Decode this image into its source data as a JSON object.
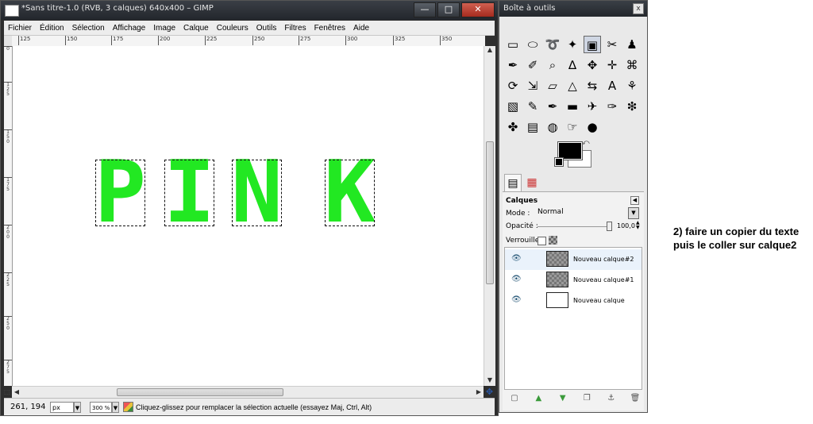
{
  "main_window": {
    "title": "*Sans titre-1.0 (RVB, 3 calques) 640x400 – GIMP",
    "controls": {
      "minimize": "—",
      "maximize": "□",
      "close": "✕"
    },
    "menu": [
      "Fichier",
      "Édition",
      "Sélection",
      "Affichage",
      "Image",
      "Calque",
      "Couleurs",
      "Outils",
      "Filtres",
      "Fenêtres",
      "Aide"
    ],
    "ruler_top_ticks": [
      "125",
      "150",
      "175",
      "200",
      "225",
      "250",
      "275",
      "300",
      "325",
      "350"
    ],
    "ruler_left_ticks": [
      "0",
      "1\n2\n5",
      "1\n5\n0",
      "1\n7\n5",
      "2\n0\n0",
      "2\n2\n5",
      "2\n5\n0",
      "2\n7\n5"
    ],
    "canvas_letters": [
      "P",
      "I",
      "N",
      "K"
    ],
    "statusbar": {
      "coords": "261, 194",
      "unit": "px",
      "zoom": "300 %",
      "message": "Cliquez-glissez pour remplacer la sélection actuelle (essayez Maj, Ctrl, Alt)"
    }
  },
  "toolbox": {
    "title": "Boîte à outils",
    "close": "x",
    "tools": [
      {
        "icon": "rect-select-icon",
        "glyph": "▭"
      },
      {
        "icon": "ellipse-select-icon",
        "glyph": "⬭"
      },
      {
        "icon": "lasso-icon",
        "glyph": "➰"
      },
      {
        "icon": "fuzzy-select-icon",
        "glyph": "✦"
      },
      {
        "icon": "color-select-icon",
        "glyph": "▣"
      },
      {
        "icon": "scissors-icon",
        "glyph": "✂"
      },
      {
        "icon": "foreground-select-icon",
        "glyph": "♟"
      },
      {
        "icon": "paths-icon",
        "glyph": "✒"
      },
      {
        "icon": "color-picker-icon",
        "glyph": "✐"
      },
      {
        "icon": "zoom-icon",
        "glyph": "⌕"
      },
      {
        "icon": "measure-icon",
        "glyph": "∆"
      },
      {
        "icon": "move-icon",
        "glyph": "✥"
      },
      {
        "icon": "align-icon",
        "glyph": "✛"
      },
      {
        "icon": "crop-icon",
        "glyph": "⌘"
      },
      {
        "icon": "rotate-icon",
        "glyph": "⟳"
      },
      {
        "icon": "scale-icon",
        "glyph": "⇲"
      },
      {
        "icon": "shear-icon",
        "glyph": "▱"
      },
      {
        "icon": "perspective-icon",
        "glyph": "△"
      },
      {
        "icon": "flip-icon",
        "glyph": "⇆"
      },
      {
        "icon": "text-icon",
        "glyph": "A"
      },
      {
        "icon": "bucket-fill-icon",
        "glyph": "⚘"
      },
      {
        "icon": "blend-icon",
        "glyph": "▧"
      },
      {
        "icon": "pencil-icon",
        "glyph": "✎"
      },
      {
        "icon": "paintbrush-icon",
        "glyph": "✒"
      },
      {
        "icon": "eraser-icon",
        "glyph": "▬"
      },
      {
        "icon": "airbrush-icon",
        "glyph": "✈"
      },
      {
        "icon": "ink-icon",
        "glyph": "✑"
      },
      {
        "icon": "clone-icon",
        "glyph": "❇"
      },
      {
        "icon": "heal-icon",
        "glyph": "✤"
      },
      {
        "icon": "perspective-clone-icon",
        "glyph": "▤"
      },
      {
        "icon": "blur-icon",
        "glyph": "◍"
      },
      {
        "icon": "smudge-icon",
        "glyph": "☞"
      },
      {
        "icon": "dodge-burn-icon",
        "glyph": "●"
      }
    ],
    "foreground_color": "#000000",
    "background_color": "#ffffff"
  },
  "layers_panel": {
    "title": "Calques",
    "mode_label": "Mode :",
    "mode_value": "Normal",
    "opacity_label": "Opacité :",
    "opacity_value": "100,0",
    "lock_label": "Verrouiller :",
    "layers": [
      {
        "name": "Nouveau calque#2",
        "thumb": "checker"
      },
      {
        "name": "Nouveau calque#1",
        "thumb": "checker"
      },
      {
        "name": "Nouveau calque",
        "thumb": "white"
      }
    ],
    "bottom_buttons": [
      "new-layer-icon",
      "raise-layer-icon",
      "lower-layer-icon",
      "duplicate-layer-icon",
      "anchor-layer-icon",
      "delete-layer-icon"
    ]
  },
  "annotation": "2) faire un copier du texte puis le coller sur calque2",
  "colors": {
    "text_fill": "#22e822"
  }
}
